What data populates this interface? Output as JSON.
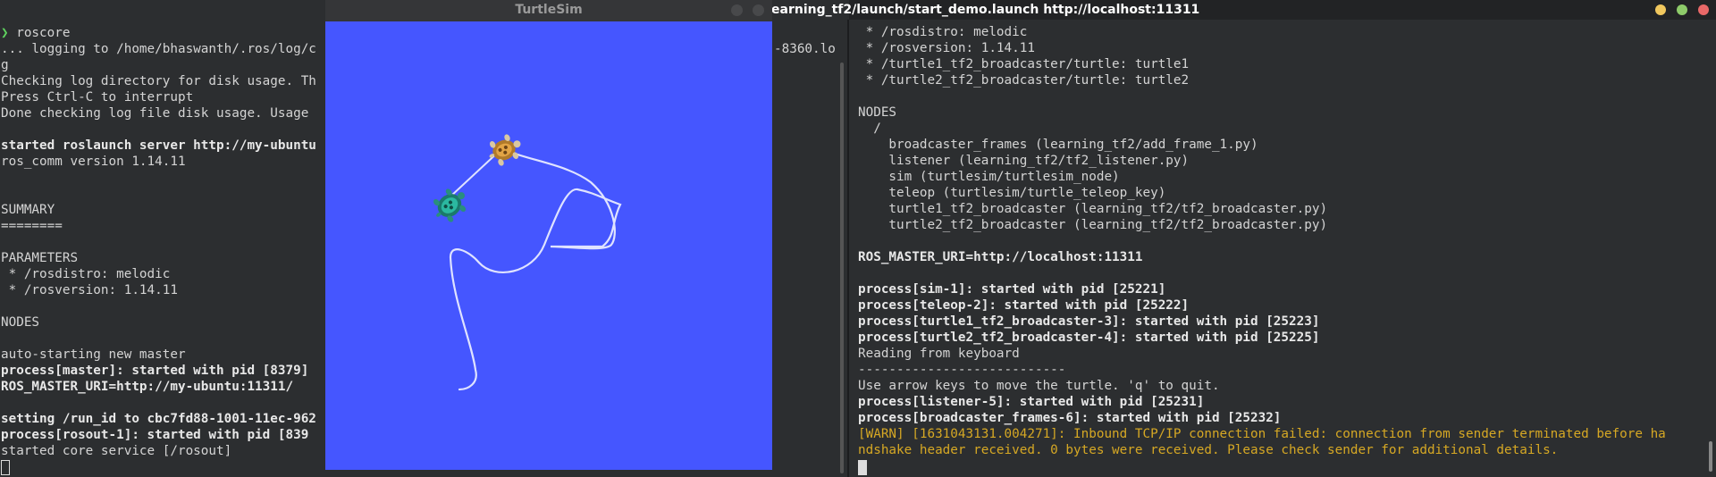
{
  "left_terminal": {
    "lines": [
      {
        "t": "roscore",
        "s": "prompt"
      },
      {
        "t": "... logging to /home/bhaswanth/.ros/log/c",
        "s": "n"
      },
      {
        "t": "g",
        "s": "n"
      },
      {
        "t": "Checking log directory for disk usage. Th",
        "s": "n"
      },
      {
        "t": "Press Ctrl-C to interrupt",
        "s": "n"
      },
      {
        "t": "Done checking log file disk usage. Usage",
        "s": "n"
      },
      {
        "t": "",
        "s": "n"
      },
      {
        "t": "started roslaunch server http://my-ubuntu",
        "s": "b"
      },
      {
        "t": "ros_comm version 1.14.11",
        "s": "n"
      },
      {
        "t": "",
        "s": "n"
      },
      {
        "t": "",
        "s": "n"
      },
      {
        "t": "SUMMARY",
        "s": "n"
      },
      {
        "t": "========",
        "s": "n"
      },
      {
        "t": "",
        "s": "n"
      },
      {
        "t": "PARAMETERS",
        "s": "n"
      },
      {
        "t": " * /rosdistro: melodic",
        "s": "n"
      },
      {
        "t": " * /rosversion: 1.14.11",
        "s": "n"
      },
      {
        "t": "",
        "s": "n"
      },
      {
        "t": "NODES",
        "s": "n"
      },
      {
        "t": "",
        "s": "n"
      },
      {
        "t": "auto-starting new master",
        "s": "n"
      },
      {
        "t": "process[master]: started with pid [8379]",
        "s": "b"
      },
      {
        "t": "ROS_MASTER_URI=http://my-ubuntu:11311/",
        "s": "b"
      },
      {
        "t": "",
        "s": "n"
      },
      {
        "t": "setting /run_id to cbc7fd88-1001-11ec-962",
        "s": "b"
      },
      {
        "t": "process[rosout-1]: started with pid [839",
        "s": "b"
      },
      {
        "t": "started core service [/rosout]",
        "s": "n"
      }
    ],
    "right_fragment": "-8360.lo"
  },
  "right_window": {
    "title": "earning_tf2/launch/start_demo.launch http://localhost:11311"
  },
  "right_terminal": {
    "lines": [
      {
        "t": " * /rosdistro: melodic",
        "s": "n"
      },
      {
        "t": " * /rosversion: 1.14.11",
        "s": "n"
      },
      {
        "t": " * /turtle1_tf2_broadcaster/turtle: turtle1",
        "s": "n"
      },
      {
        "t": " * /turtle2_tf2_broadcaster/turtle: turtle2",
        "s": "n"
      },
      {
        "t": "",
        "s": "n"
      },
      {
        "t": "NODES",
        "s": "n"
      },
      {
        "t": "  /",
        "s": "n"
      },
      {
        "t": "    broadcaster_frames (learning_tf2/add_frame_1.py)",
        "s": "n"
      },
      {
        "t": "    listener (learning_tf2/tf2_listener.py)",
        "s": "n"
      },
      {
        "t": "    sim (turtlesim/turtlesim_node)",
        "s": "n"
      },
      {
        "t": "    teleop (turtlesim/turtle_teleop_key)",
        "s": "n"
      },
      {
        "t": "    turtle1_tf2_broadcaster (learning_tf2/tf2_broadcaster.py)",
        "s": "n"
      },
      {
        "t": "    turtle2_tf2_broadcaster (learning_tf2/tf2_broadcaster.py)",
        "s": "n"
      },
      {
        "t": "",
        "s": "n"
      },
      {
        "t": "ROS_MASTER_URI=http://localhost:11311",
        "s": "b"
      },
      {
        "t": "",
        "s": "n"
      },
      {
        "t": "process[sim-1]: started with pid [25221]",
        "s": "b"
      },
      {
        "t": "process[teleop-2]: started with pid [25222]",
        "s": "b"
      },
      {
        "t": "process[turtle1_tf2_broadcaster-3]: started with pid [25223]",
        "s": "b"
      },
      {
        "t": "process[turtle2_tf2_broadcaster-4]: started with pid [25225]",
        "s": "b"
      },
      {
        "t": "Reading from keyboard",
        "s": "n"
      },
      {
        "t": "---------------------------",
        "s": "n"
      },
      {
        "t": "Use arrow keys to move the turtle. 'q' to quit.",
        "s": "n"
      },
      {
        "t": "process[listener-5]: started with pid [25231]",
        "s": "b"
      },
      {
        "t": "process[broadcaster_frames-6]: started with pid [25232]",
        "s": "b"
      },
      {
        "t": "[WARN] [1631043131.004271]: Inbound TCP/IP connection failed: connection from sender terminated before ha",
        "s": "w"
      },
      {
        "t": "ndshake header received. 0 bytes were received. Please check sender for additional details.",
        "s": "w"
      }
    ]
  },
  "turtlesim": {
    "title": "TurtleSim",
    "background": "#4556ff"
  },
  "colors": {
    "warn": "#d6a824",
    "prompt": "#5fd35f",
    "btn_min": "#f0c75e",
    "btn_max": "#8ecb6a",
    "btn_close": "#e96868"
  }
}
